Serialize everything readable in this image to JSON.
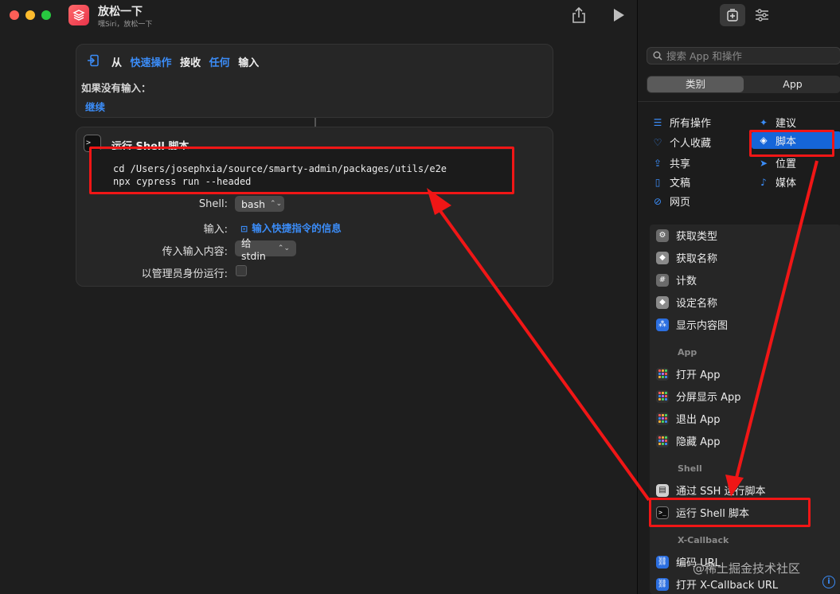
{
  "window": {
    "title": "放松一下",
    "subtitle": "嘿Siri，放松一下"
  },
  "input_card": {
    "prefix": "从",
    "source": "快速操作",
    "verb": "接收",
    "type": "任何",
    "suffix": "输入",
    "no_input_label": "如果没有输入：",
    "no_input_action": "继续"
  },
  "shell_card": {
    "title": "运行 Shell 脚本",
    "script_lines": [
      "cd /Users/josephxia/source/smarty-admin/packages/utils/e2e",
      "npx cypress run --headed"
    ],
    "shell_label": "Shell:",
    "shell_value": "bash",
    "input_label": "输入:",
    "input_value": "输入快捷指令的信息",
    "pass_label": "传入输入内容:",
    "pass_value": "给 stdin",
    "admin_label": "以管理员身份运行:",
    "admin_checked": false
  },
  "library": {
    "search_placeholder": "搜索 App 和操作",
    "segments": [
      "类别",
      "App"
    ],
    "active_segment": 0,
    "categories_left": [
      {
        "label": "所有操作",
        "icon": "list-icon"
      },
      {
        "label": "个人收藏",
        "icon": "heart-icon"
      },
      {
        "label": "共享",
        "icon": "share-icon"
      },
      {
        "label": "文稿",
        "icon": "document-icon"
      },
      {
        "label": "网页",
        "icon": "compass-icon"
      }
    ],
    "categories_right": [
      {
        "label": "建议",
        "icon": "sparkle-icon"
      },
      {
        "label": "脚本",
        "icon": "script-icon",
        "selected": true
      },
      {
        "label": "位置",
        "icon": "location-icon"
      },
      {
        "label": "媒体",
        "icon": "music-icon"
      }
    ],
    "actions_top": [
      "获取类型",
      "获取名称",
      "计数",
      "设定名称",
      "显示内容图"
    ],
    "section_app": "App",
    "actions_app": [
      "打开 App",
      "分屏显示 App",
      "退出 App",
      "隐藏 App"
    ],
    "section_shell": "Shell",
    "actions_shell": [
      "通过 SSH 运行脚本",
      "运行 Shell 脚本"
    ],
    "section_xcallback": "X-Callback",
    "actions_xcallback": [
      "编码 URL",
      "打开 X-Callback URL"
    ]
  },
  "watermark": "@稀土掘金技术社区",
  "colors": {
    "accent": "#3b8cf7",
    "annotation": "#f01616",
    "selected_category": "#1565d8"
  }
}
